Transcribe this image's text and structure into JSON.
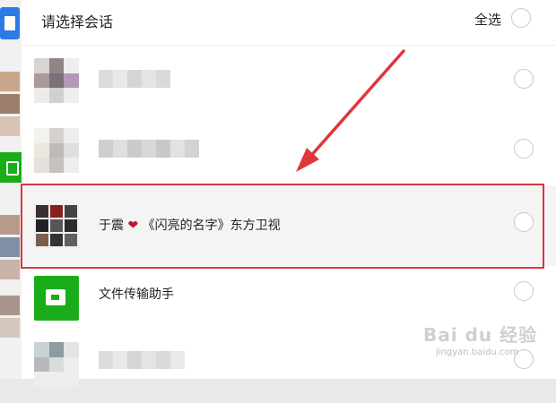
{
  "dialog": {
    "title": "请选择会话",
    "select_all_label": "全选"
  },
  "conversations": [
    {
      "name": "",
      "blurred": true,
      "selected": false
    },
    {
      "name": "",
      "blurred": true,
      "selected": false
    },
    {
      "name_prefix": "于震",
      "name_icon": "heart-icon",
      "name_suffix": "《闪亮的名字》东方卫视",
      "blurred": false,
      "highlighted": true,
      "selected": false
    },
    {
      "name": "文件传输助手",
      "icon": "file-transfer-icon",
      "blurred": false,
      "selected": false
    },
    {
      "name": "",
      "blurred": true,
      "selected": false
    }
  ],
  "annotation": {
    "arrow_color": "#e0363b",
    "highlight_color": "#d9363e"
  },
  "watermark": {
    "brand": "Bai du 经验",
    "url": "jingyan.baidu.com"
  }
}
